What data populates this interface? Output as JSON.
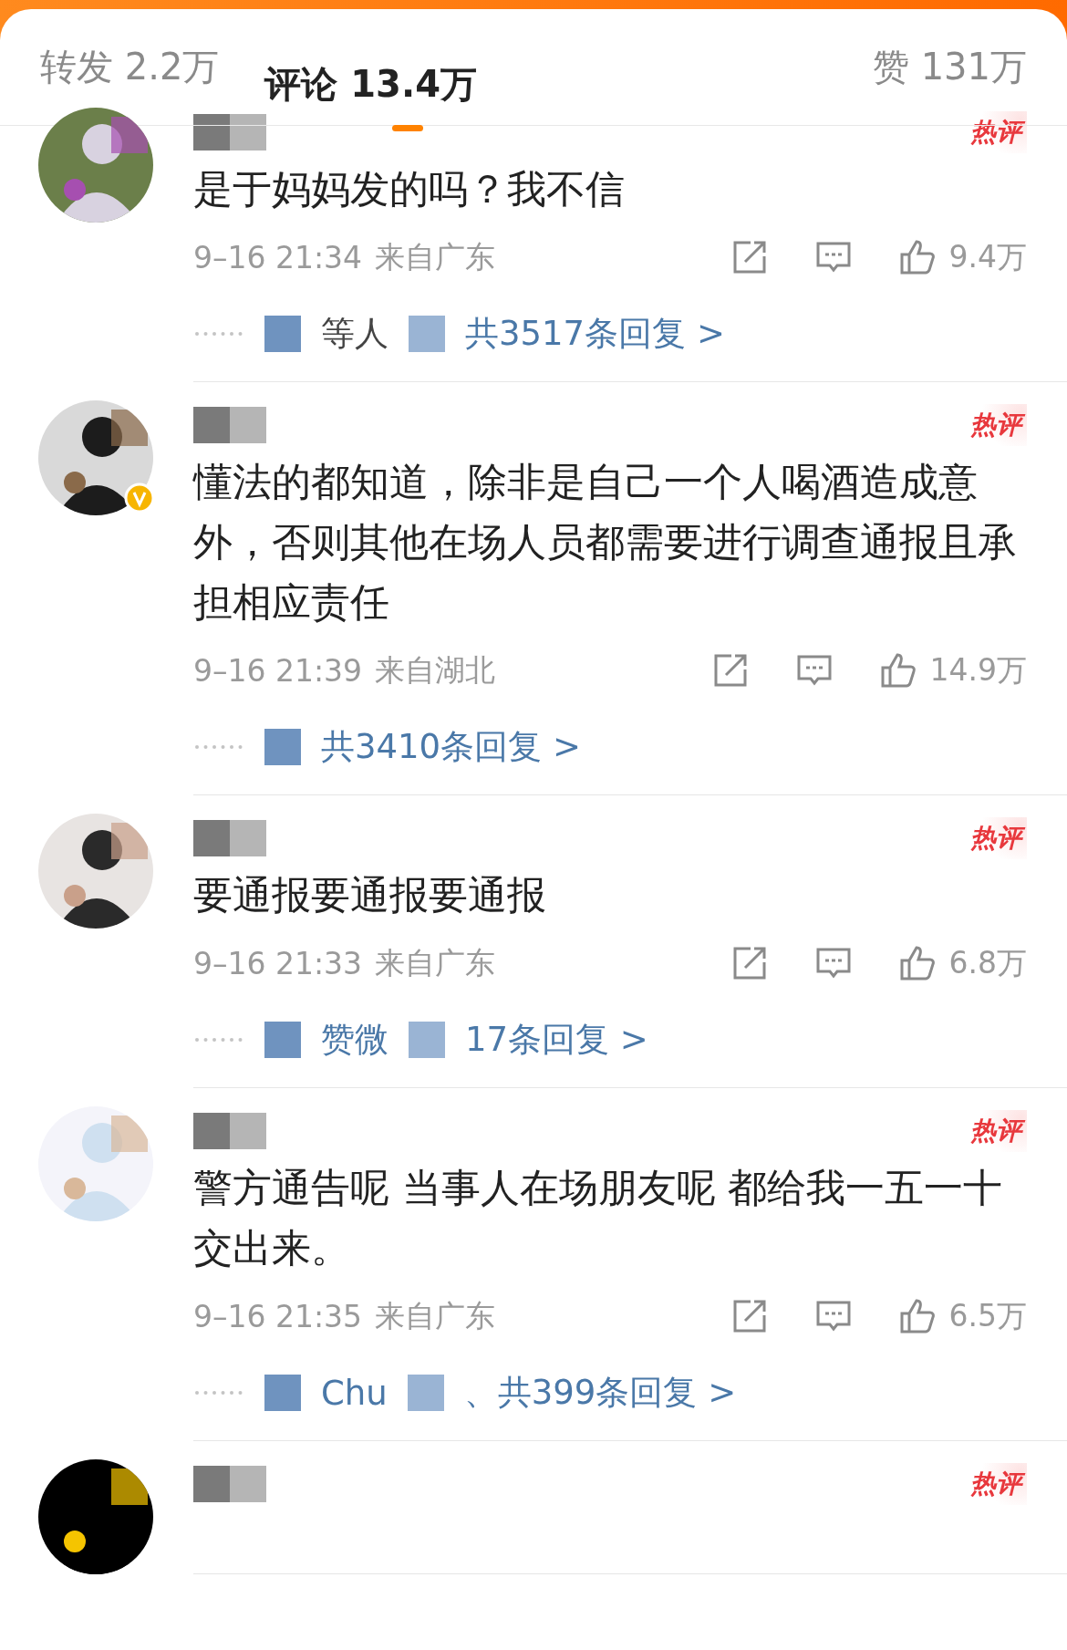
{
  "tabs": [
    {
      "label": "转发",
      "count": "2.2万",
      "selected": false
    },
    {
      "label": "评论",
      "count": "13.4万",
      "selected": true
    }
  ],
  "likes": {
    "label": "赞",
    "count": "131万"
  },
  "comments": [
    {
      "hot_label": "热评",
      "verified": false,
      "text": "是于妈妈发的吗？我不信",
      "time": "9–16 21:34",
      "location": "来自广东",
      "like_count": "9.4万",
      "replies": [
        "等人",
        "共3517条回复 >"
      ]
    },
    {
      "hot_label": "热评",
      "verified": true,
      "text": "懂法的都知道，除非是自己一个人喝酒造成意外，否则其他在场人员都需要进行调查通报且承担相应责任",
      "time": "9–16 21:39",
      "location": "来自湖北",
      "like_count": "14.9万",
      "replies": [
        "共3410条回复 >"
      ]
    },
    {
      "hot_label": "热评",
      "verified": false,
      "text": "要通报要通报要通报",
      "time": "9–16 21:33",
      "location": "来自广东",
      "like_count": "6.8万",
      "replies": [
        "赞微",
        "17条回复 >"
      ]
    },
    {
      "hot_label": "热评",
      "verified": false,
      "text": "警方通告呢 当事人在场朋友呢 都给我一五一十交出来。",
      "time": "9–16 21:35",
      "location": "来自广东",
      "like_count": "6.5万",
      "replies": [
        "Chu",
        "、共399条回复 >"
      ]
    },
    {
      "hot_label": "热评",
      "verified": false
    }
  ]
}
